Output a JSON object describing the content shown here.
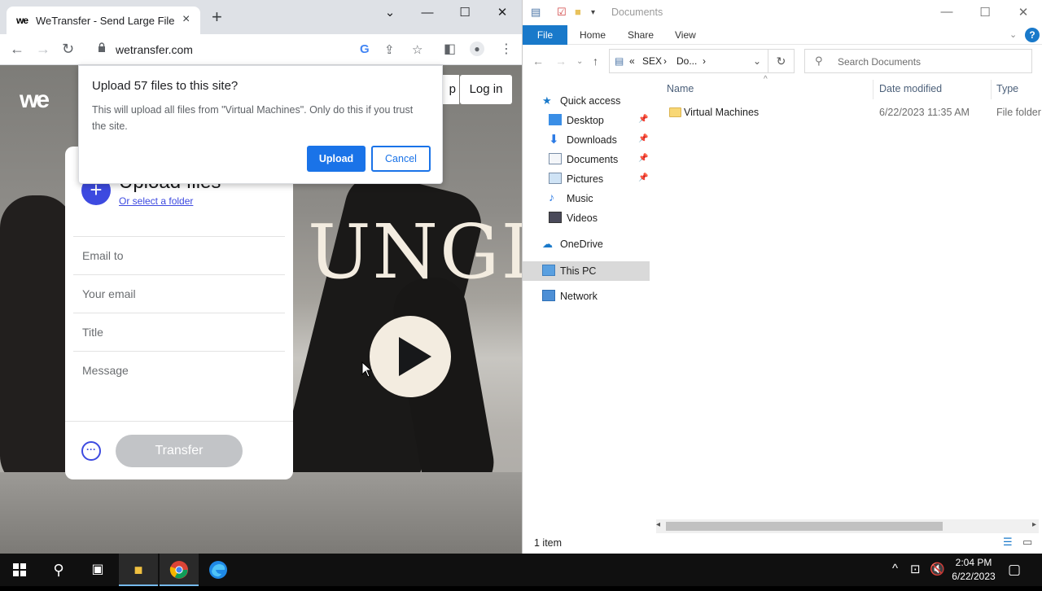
{
  "chrome": {
    "tab_title": "WeTransfer - Send Large Files & Sha",
    "tab_favicon": "we",
    "url": "wetransfer.com",
    "new_tab": "+",
    "tab_close": "×"
  },
  "wetransfer": {
    "logo": "we",
    "signup_fragment": "p",
    "login_label": "Log in",
    "hero_text": "UNGL",
    "card": {
      "title": "Upload files",
      "select_folder": "Or select a folder",
      "email_to": "Email to",
      "your_email": "Your email",
      "title_field": "Title",
      "message": "Message",
      "more": "···",
      "transfer": "Transfer"
    }
  },
  "dialog": {
    "title": "Upload 57 files to this site?",
    "message": "This will upload all files from \"Virtual Machines\". Only do this if you trust the site.",
    "upload": "Upload",
    "cancel": "Cancel"
  },
  "explorer": {
    "title": "Documents",
    "ribbon_tabs": [
      "File",
      "Home",
      "Share",
      "View"
    ],
    "help": "?",
    "breadcrumb": {
      "chevron": "«",
      "p1": "SEX",
      "sep": "›",
      "p2": "Do...",
      "sep2": "›"
    },
    "search_placeholder": "Search Documents",
    "nav": {
      "quick_access": "Quick access",
      "desktop": "Desktop",
      "downloads": "Downloads",
      "documents": "Documents",
      "pictures": "Pictures",
      "music": "Music",
      "videos": "Videos",
      "onedrive": "OneDrive",
      "this_pc": "This PC",
      "network": "Network"
    },
    "columns": {
      "name": "Name",
      "date": "Date modified",
      "type": "Type"
    },
    "files": [
      {
        "name": "Virtual Machines",
        "date": "6/22/2023 11:35 AM",
        "type": "File folder"
      }
    ],
    "status": "1 item"
  },
  "taskbar": {
    "time": "2:04 PM",
    "date": "6/22/2023"
  }
}
